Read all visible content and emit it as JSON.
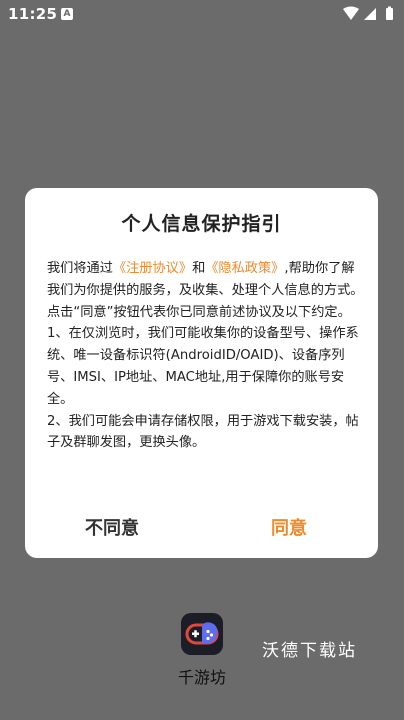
{
  "status_bar": {
    "time": "11:25",
    "notification_icon": "A",
    "icons": [
      "wifi-icon",
      "signal-icon",
      "battery-icon"
    ]
  },
  "dialog": {
    "title": "个人信息保护指引",
    "intro_before": "我们将通过",
    "link_register": "《注册协议》",
    "intro_and": "和",
    "link_privacy": "《隐私政策》",
    "intro_after": ",帮助你了解我们为你提供的服务，及收集、处理个人信息的方式。",
    "paragraph_consent": " 点击“同意”按钮代表你已同意前述协议及以下约定。",
    "paragraph_1": " 1、在仅浏览时，我们可能收集你的设备型号、操作系统、唯一设备标识符(AndroidID/OAID)、设备序列号、IMSI、IP地址、MAC地址,用于保障你的账号安全。",
    "paragraph_2": " 2、我们可能会申请存储权限，用于游戏下载安装，帖子及群聊发图，更换头像。",
    "disagree_label": "不同意",
    "agree_label": "同意"
  },
  "app": {
    "name": "千游坊",
    "icon": "gamepad-icon"
  },
  "watermark": "沃德下载站",
  "colors": {
    "overlay_background": "#6b6b6b",
    "dialog_background": "#ffffff",
    "accent": "#f08a2a",
    "text_primary": "#222222",
    "app_icon_background": "#1d1d28"
  }
}
